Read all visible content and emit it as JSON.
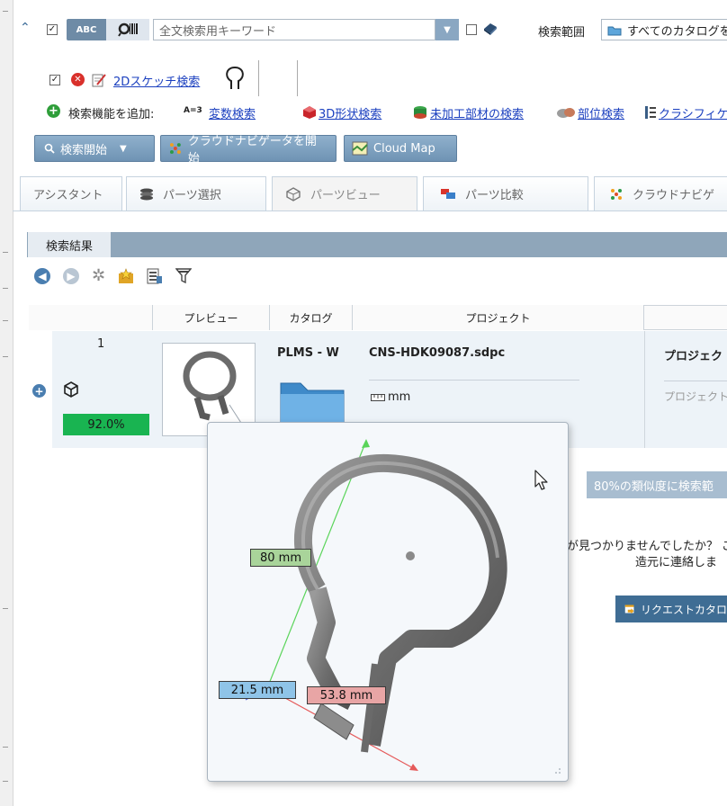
{
  "toolbar": {
    "abc_label": "ABC",
    "search_placeholder": "全文検索用キーワード",
    "range_label": "検索範囲",
    "range_value": "すべてのカタログを"
  },
  "sketch": {
    "link": "2Dスケッチ検索"
  },
  "addfunc": {
    "label": "検索機能を追加:",
    "var_prefix": "A=3",
    "var_link": "変数検索",
    "shape_link": "3D形状検索",
    "raw_link": "未加工部材の検索",
    "part_link": "部位検索",
    "class_link": "クラシフィケ"
  },
  "actions": {
    "search_start": "検索開始",
    "cloud_nav_start": "クラウドナビゲータを開始",
    "cloud_map": "Cloud Map"
  },
  "tabs": [
    "アシスタント",
    "パーツ選択",
    "パーツビュー",
    "パーツ比較",
    "クラウドナビゲ"
  ],
  "results": {
    "tab_label": "検索結果",
    "columns": [
      "プレビュー",
      "カタログ",
      "プロジェクト"
    ],
    "row": {
      "index": "1",
      "similarity": "92.0%",
      "catalog": "PLMS - W",
      "project": "CNS-HDK09087.sdpc",
      "unit": "mm",
      "right_title": "プロジェク",
      "right_sub": "プロジェクト"
    }
  },
  "side": {
    "similarity_msg": "80%の類似度に検索範",
    "not_found_1": "が見つかりませんでしたか？ ご",
    "not_found_2": "造元に連絡しま",
    "request_btn": "リクエストカタロ"
  },
  "preview3d": {
    "dim_green": "80 mm",
    "dim_blue": "21.5 mm",
    "dim_red": "53.8 mm"
  },
  "colors": {
    "similarity_green": "#19b451",
    "header_bar": "#8fa6ba",
    "request_btn": "#3f6d94",
    "similarity_btn": "#a8bdd0"
  }
}
